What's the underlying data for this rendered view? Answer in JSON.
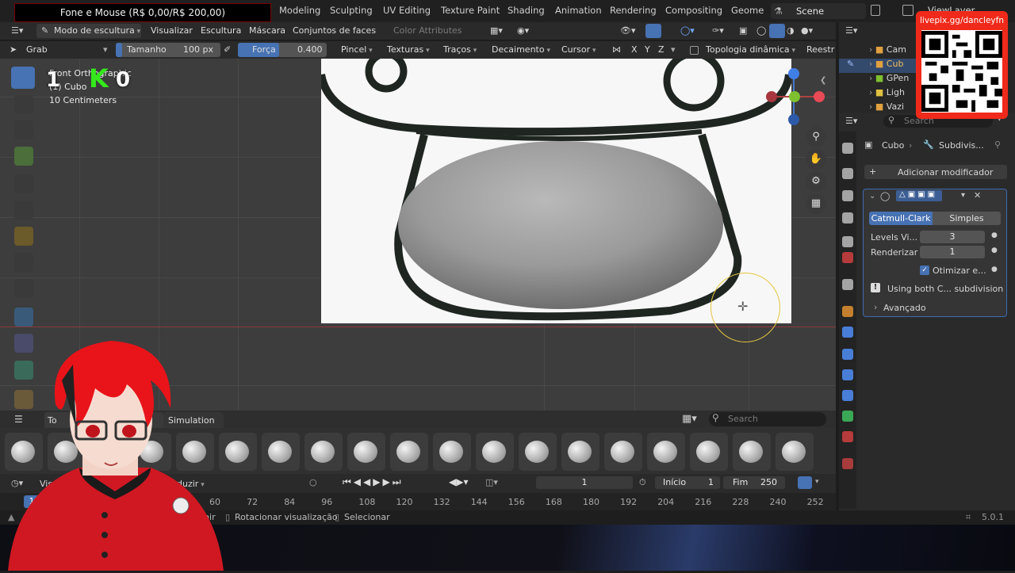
{
  "donation_banner": "Fone e Mouse (R$ 0,00/R$ 200,00)",
  "workspace_tabs": [
    "Modeling",
    "Sculpting",
    "UV Editing",
    "Texture Paint",
    "Shading",
    "Animation",
    "Rendering",
    "Compositing",
    "Geome"
  ],
  "scene": "Scene",
  "view_layer": "ViewLayer",
  "header1": {
    "mode": "Modo de escultura",
    "menus": [
      "Visualizar",
      "Escultura",
      "Máscara",
      "Conjuntos de faces"
    ],
    "color_attributes": "Color Attributes"
  },
  "header2": {
    "brush": "Grab",
    "size_label": "Tamanho",
    "size_value": "100 px",
    "strength_label": "Força",
    "strength_value": "0.400",
    "dropdowns": [
      "Pincel",
      "Texturas",
      "Traços",
      "Decaimento",
      "Cursor"
    ],
    "axes": [
      "X",
      "Y",
      "Z"
    ],
    "dyntopo": "Topologia dinâmica",
    "remesh": "Reestr"
  },
  "viewport": {
    "view_name": "Front Orthographic",
    "object_line": "(1) Cubo",
    "scale": "10 Centimeters",
    "overlay_big": "1",
    "overlay_k": "K",
    "overlay_zero": "0"
  },
  "shelf": {
    "tabs": [
      "To",
      "Simulation"
    ],
    "search_placeholder": "Search",
    "brush_count": 19
  },
  "timeline": {
    "view_menu": "Visu",
    "playback_menu": "roduzir",
    "current_frame": "1",
    "start_label": "Início",
    "start_value": "1",
    "end_label": "Fim",
    "end_value": "250",
    "ticks": [
      "60",
      "72",
      "84",
      "96",
      "108",
      "120",
      "132",
      "144",
      "156",
      "168",
      "180",
      "192",
      "204",
      "216",
      "228",
      "240",
      "252"
    ],
    "frame_marker": "1"
  },
  "status": {
    "help": "lpir",
    "rotate": "Rotacionar visualização",
    "select": "Selecionar",
    "version": "5.0.1"
  },
  "outliner": {
    "items": [
      "Cam",
      "Cub",
      "GPen",
      "Ligh",
      "Vazi"
    ]
  },
  "properties": {
    "search_placeholder": "Search",
    "breadcrumb_object": "Cubo",
    "breadcrumb_modifier": "Subdivis...",
    "add_modifier": "Adicionar modificador",
    "method_active": "Catmull-Clark",
    "method_other": "Simples",
    "levels_label": "Levels Vi...",
    "levels_value": "3",
    "render_label": "Renderizar",
    "render_value": "1",
    "optimize_label": "Otimizar e...",
    "info": "Using both C... subdivision",
    "advanced": "Avançado"
  },
  "qr": {
    "url": "livepix.gg/dancleyfn"
  },
  "colors": {
    "accent": "#4772b3",
    "qr_card": "#f02a1a",
    "avatar_hair": "#e8141a",
    "cursor_ring": "#e6c640"
  }
}
